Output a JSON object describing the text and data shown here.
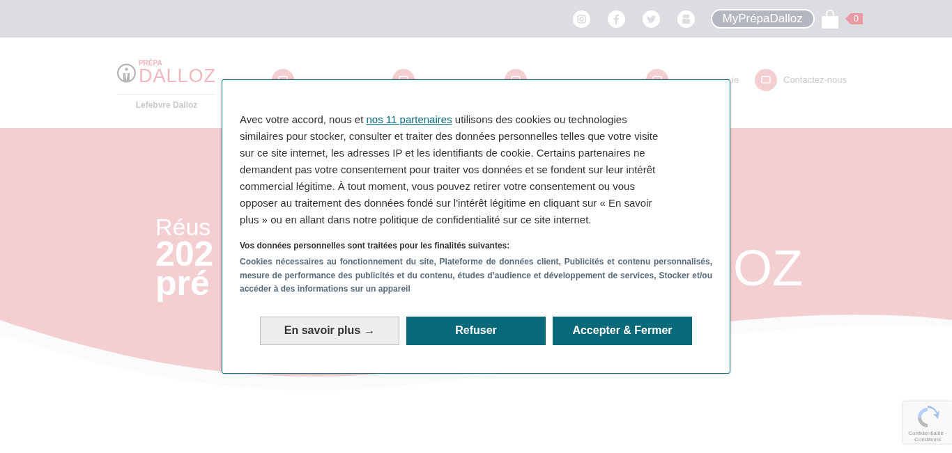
{
  "top_bar": {
    "social": [
      {
        "kind": "instagram"
      },
      {
        "kind": "facebook"
      },
      {
        "kind": "twitter"
      },
      {
        "kind": "youtube"
      }
    ],
    "account_button": "MyPrépaDalloz",
    "cart_count": "0"
  },
  "logo": {
    "top": "PRÉPA",
    "main": "DALLOZ",
    "sub": "Lefebvre Dalloz"
  },
  "nav": [
    {
      "kind": "link"
    },
    {
      "kind": "link"
    },
    {
      "kind": "link"
    },
    {
      "kind": "link",
      "label": "ie"
    },
    {
      "kind": "link",
      "label": "Contactez-nous"
    }
  ],
  "hero": {
    "line_1": "Réus",
    "line_2": "202",
    "line_3": "pré",
    "logo_fragment": "OZ"
  },
  "cookie_dialog": {
    "intro_before": "Avec votre accord, nous et ",
    "intro_link": "nos 11 partenaires",
    "intro_after": " utilisons des cookies ou technologies similaires pour stocker, consulter et traiter des données personnelles telles que votre visite sur ce site internet, les adresses IP et les identifiants de cookie. Certains partenaires ne demandent pas votre consentement pour traiter vos données et se fondent sur leur intérêt commercial légitime. À tout moment, vous pouvez retirer votre consentement ou vous opposer au traitement des données fondé sur l'intérêt légitime en cliquant sur « En savoir plus » ou en allant dans notre politique de confidentialité sur ce site internet.",
    "purposes_title": "Vos données personnelles sont traitées pour les finalités suivantes:",
    "purposes": "Cookies nécessaires au fonctionnement du site, Plateforme de données client, Publicités et contenu personnalisés, mesure de performance des publicités et du contenu, études d’audience et développement de services, Stocker et/ou accéder à des informations sur un appareil",
    "buttons": [
      {
        "kind": "secondary",
        "label": "En savoir plus",
        "arrow": "→"
      },
      {
        "kind": "primary",
        "label": "Refuser"
      },
      {
        "kind": "primary",
        "label": "Accepter & Fermer"
      }
    ]
  },
  "recaptcha": {
    "links": "Confidentialité - Conditions"
  }
}
